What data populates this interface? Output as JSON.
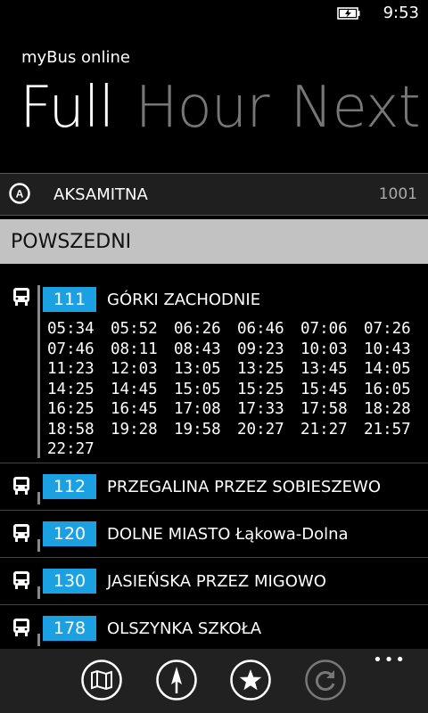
{
  "status": {
    "time": "9:53"
  },
  "app": {
    "title": "myBus online"
  },
  "pivot": {
    "items": [
      "Full",
      "Hour",
      "Next"
    ]
  },
  "stop": {
    "letter": "A",
    "name": "AKSAMITNA",
    "code": "1001"
  },
  "day_type": "POWSZEDNI",
  "routes": [
    {
      "number": "111",
      "destination": "GÓRKI ZACHODNIE",
      "times": [
        "05:34",
        "05:52",
        "06:26",
        "06:46",
        "07:06",
        "07:26",
        "07:46",
        "08:11",
        "08:43",
        "09:23",
        "10:03",
        "10:43",
        "11:23",
        "12:03",
        "13:05",
        "13:25",
        "13:45",
        "14:05",
        "14:25",
        "14:45",
        "15:05",
        "15:25",
        "15:45",
        "16:05",
        "16:25",
        "16:45",
        "17:08",
        "17:33",
        "17:58",
        "18:28",
        "18:58",
        "19:28",
        "19:58",
        "20:27",
        "21:27",
        "21:57",
        "22:27"
      ]
    },
    {
      "number": "112",
      "destination": "PRZEGALINA PRZEZ SOBIESZEWO"
    },
    {
      "number": "120",
      "destination": "DOLNE MIASTO Łąkowa-Dolna"
    },
    {
      "number": "130",
      "destination": "JASIEŃSKA PRZEZ MIGOWO"
    },
    {
      "number": "178",
      "destination": "OLSZYNKA SZKOŁA"
    }
  ],
  "appbar": {
    "buttons": [
      "map-icon",
      "compass-icon",
      "star-icon",
      "refresh-icon"
    ],
    "more": "•••"
  },
  "colors": {
    "accent": "#1ba1e2",
    "background": "#000000",
    "day_bar": "#c2c2c2"
  }
}
